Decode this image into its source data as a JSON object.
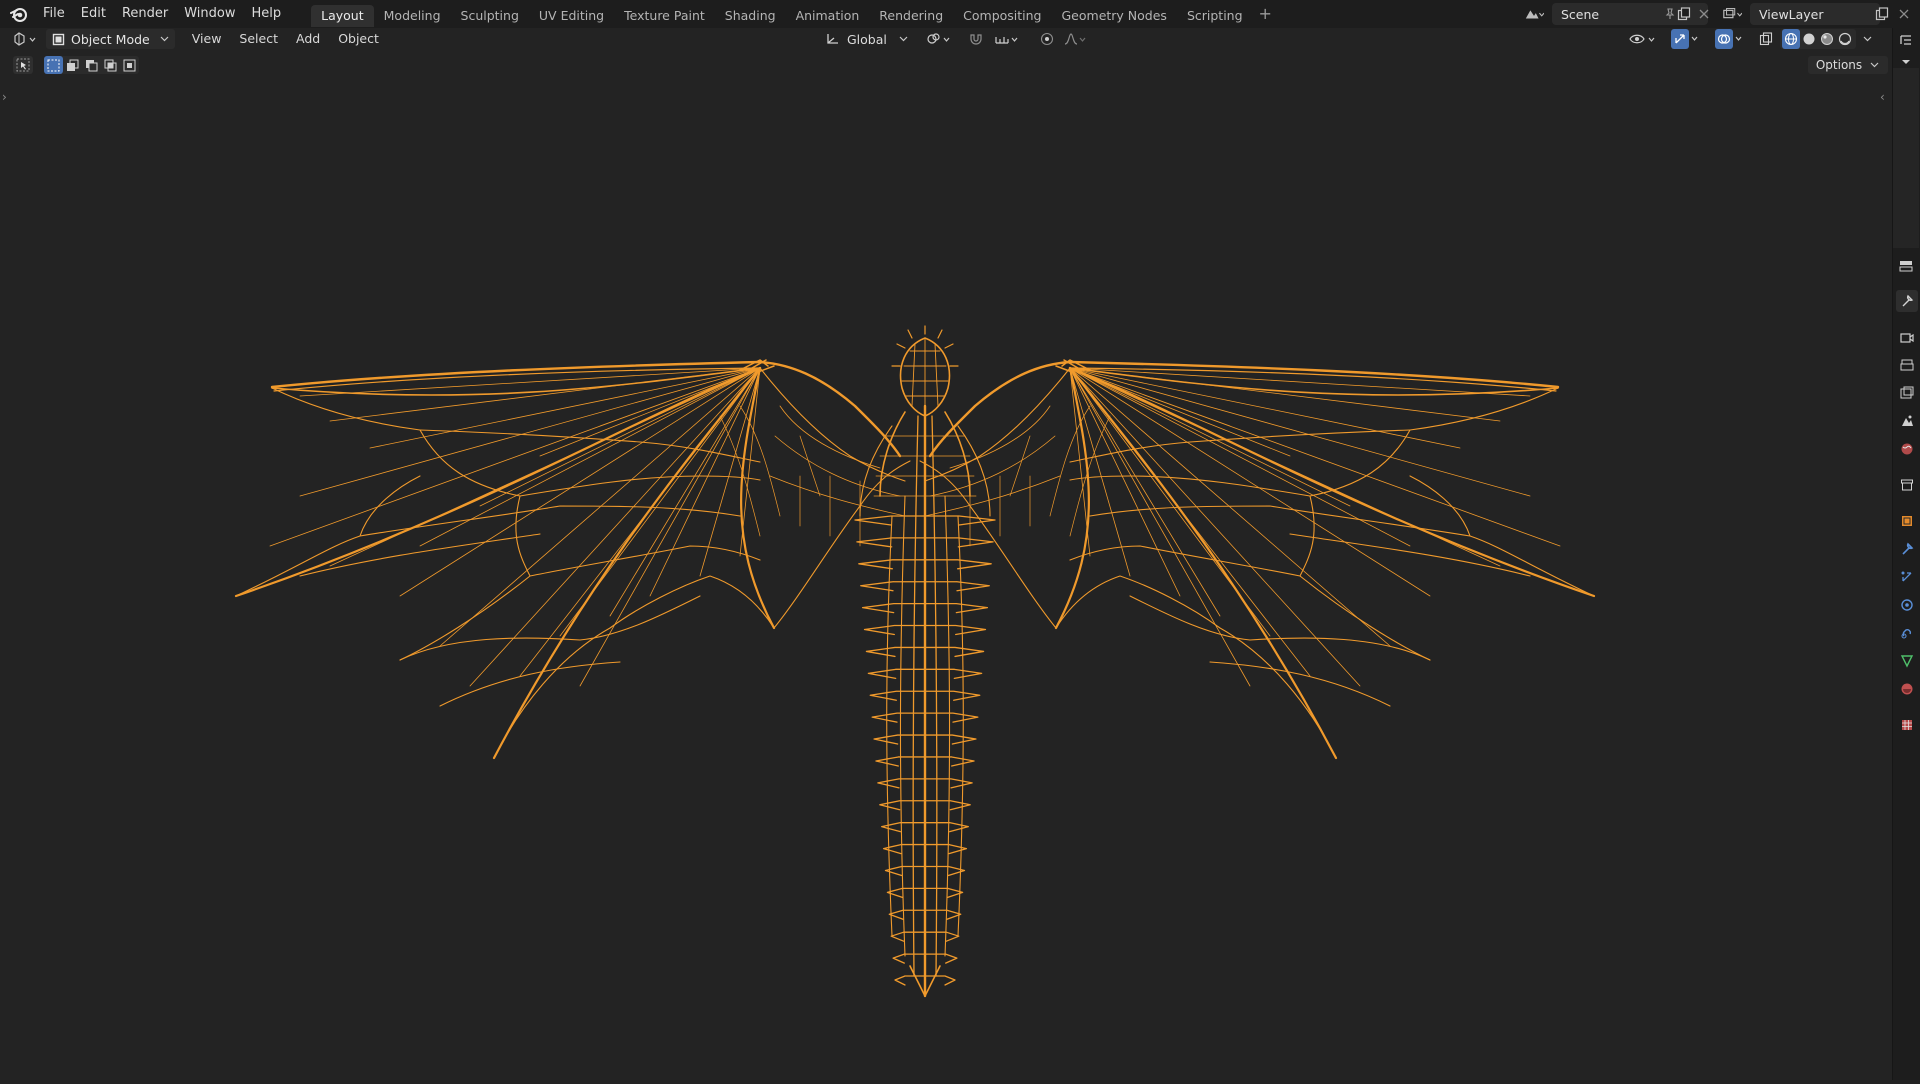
{
  "topbar": {
    "menus": [
      "File",
      "Edit",
      "Render",
      "Window",
      "Help"
    ],
    "workspaces": [
      "Layout",
      "Modeling",
      "Sculpting",
      "UV Editing",
      "Texture Paint",
      "Shading",
      "Animation",
      "Rendering",
      "Compositing",
      "Geometry Nodes",
      "Scripting"
    ],
    "active_workspace": "Layout",
    "add_workspace": "+",
    "scene": "Scene",
    "view_layer": "ViewLayer"
  },
  "header": {
    "mode": "Object Mode",
    "menus": [
      "View",
      "Select",
      "Add",
      "Object"
    ],
    "transform_orientation": "Global",
    "options_label": "Options"
  },
  "viewport": {
    "object": "dragon-wireframe",
    "wire_color": "#f09a2c",
    "background": "#232323"
  },
  "colors": {
    "accent": "#4772b3",
    "topbar_bg": "#1d1d1d",
    "viewport_bg": "#232323"
  },
  "properties_tabs": [
    "tool-icon",
    "render-icon",
    "output-icon",
    "view-layer-icon",
    "scene-icon",
    "world-icon",
    "collection-icon",
    "object-icon",
    "modifier-icon",
    "particles-icon",
    "physics-icon",
    "constraints-icon",
    "data-icon",
    "material-icon",
    "texture-icon"
  ]
}
